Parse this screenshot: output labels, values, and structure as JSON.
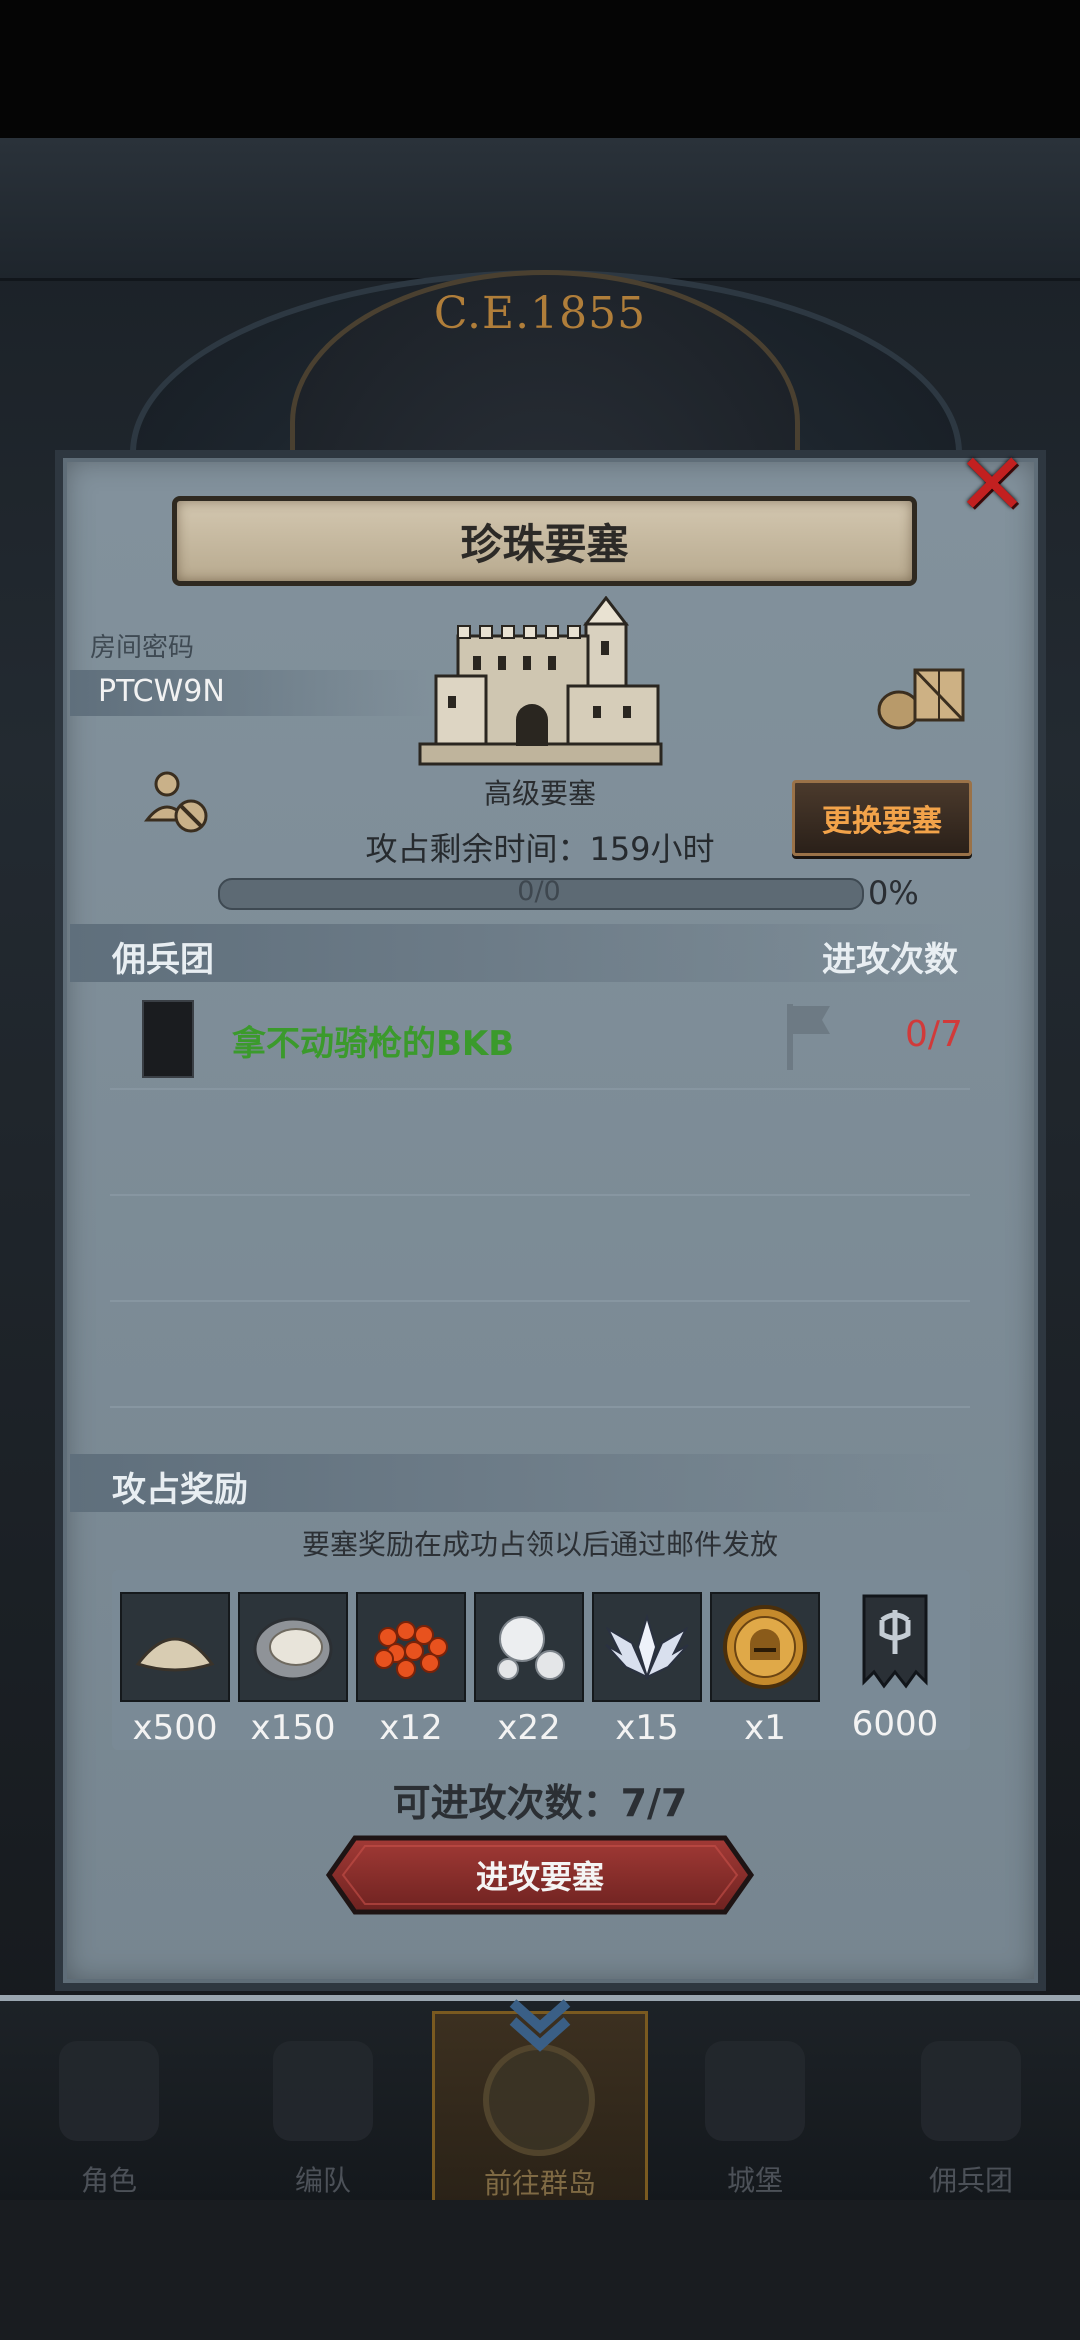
{
  "background": {
    "year_label": "C.E.1855"
  },
  "modal": {
    "title": "珍珠要塞",
    "close_icon": "close-x-icon",
    "room": {
      "label": "房间密码",
      "code": "PTCW9N"
    },
    "fortress": {
      "level_label": "高级要塞",
      "change_button": "更换要塞",
      "time_remaining": "攻占剩余时间：159小时",
      "progress_text": "0/0",
      "progress_percent": "0%",
      "progress_fraction": 0
    },
    "mercenary_section": {
      "title": "佣兵团",
      "right_label": "进攻次数",
      "members": [
        {
          "name": "拿不动骑枪的BKB",
          "attack_count": "0/7"
        }
      ]
    },
    "reward_section": {
      "title": "攻占奖励",
      "note": "要塞奖励在成功占领以后通过邮件发放",
      "items": [
        {
          "icon": "sand-pile-icon",
          "qty": "x500"
        },
        {
          "icon": "oyster-icon",
          "qty": "x150"
        },
        {
          "icon": "fish-roe-icon",
          "qty": "x12"
        },
        {
          "icon": "pearls-icon",
          "qty": "x22"
        },
        {
          "icon": "winged-emblem-icon",
          "qty": "x15"
        },
        {
          "icon": "golden-helmet-coin-icon",
          "qty": "x1"
        },
        {
          "icon": "guild-banner-icon",
          "qty": "6000"
        }
      ]
    },
    "attacks_available": "可进攻次数：7/7",
    "attack_button": "进攻要塞"
  },
  "bottom_nav": {
    "items": [
      {
        "label": "角色",
        "icon": "knight-helmet-icon"
      },
      {
        "label": "编队",
        "icon": "formation-icon"
      },
      {
        "label": "前往群岛",
        "icon": "island-map-icon",
        "active": true
      },
      {
        "label": "城堡",
        "icon": "castle-icon"
      },
      {
        "label": "佣兵团",
        "icon": "mercenary-banner-icon"
      }
    ]
  },
  "colors": {
    "panel": "#7d8d98",
    "accent_orange": "#f2a34a",
    "member_name_green": "#3b9a2c",
    "count_red": "#d13a3a",
    "close_red": "#c22020",
    "attack_button_red": "#8e2e2c"
  }
}
